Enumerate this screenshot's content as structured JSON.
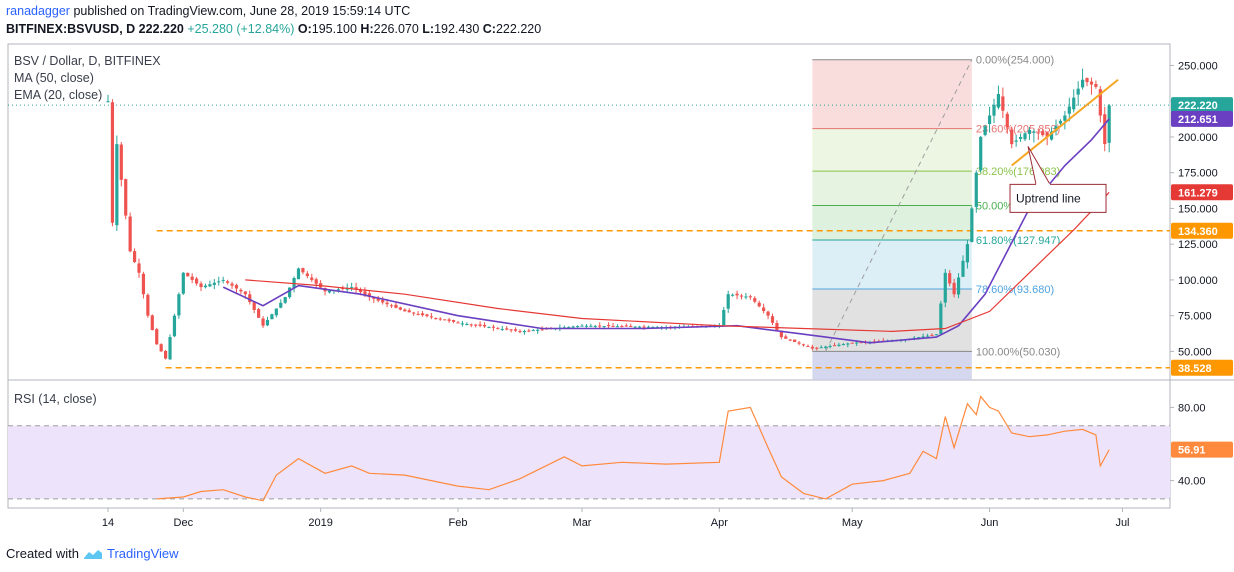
{
  "header": {
    "author": "ranadagger",
    "published_text": "published on TradingView.com, June 28, 2019 15:59:14 UTC",
    "symbol": "BITFINEX:BSVUSD, D",
    "last": "222.220",
    "change": "+25.280 (+12.84%)",
    "o_label": "O:",
    "o_value": "195.100",
    "h_label": "H:",
    "h_value": "226.070",
    "l_label": "L:",
    "l_value": "192.430",
    "c_label": "C:",
    "c_value": "222.220"
  },
  "legend": {
    "title": "BSV / Dollar, D, BITFINEX",
    "ma": "MA (50, close)",
    "ema": "EMA (20, close)",
    "rsi": "RSI (14, close)"
  },
  "footer": {
    "created_with": "Created with",
    "brand": "TradingView"
  },
  "colors": {
    "up": "#26a69a",
    "down": "#ef5350",
    "ma": "#6a3fc1",
    "ema": "#e53935",
    "support": "#ff9800",
    "uptrend": "#f5a623",
    "rsi": "#ff8a3d",
    "rsi_band": "#ede4fb"
  },
  "chart_data": [
    {
      "type": "candlestick",
      "title": "BSV / Dollar, D, BITFINEX",
      "ylim": [
        30,
        265
      ],
      "y_ticks": [
        50,
        75,
        100,
        125,
        150,
        175,
        200,
        225,
        250
      ],
      "y_tick_labels": [
        "50.000",
        "75.000",
        "100.000",
        "125.000",
        "150.000",
        "175.000",
        "200.000",
        "225.000",
        "250.000"
      ],
      "x_ticks": [
        {
          "label": "14",
          "date": "2018-11-14"
        },
        {
          "label": "Dec",
          "date": "2018-12-01"
        },
        {
          "label": "2019",
          "date": "2019-01-01"
        },
        {
          "label": "Feb",
          "date": "2019-02-01"
        },
        {
          "label": "Mar",
          "date": "2019-03-01"
        },
        {
          "label": "Apr",
          "date": "2019-04-01"
        },
        {
          "label": "May",
          "date": "2019-05-01"
        },
        {
          "label": "Jun",
          "date": "2019-06-01"
        },
        {
          "label": "Jul",
          "date": "2019-07-01"
        }
      ],
      "date_range": [
        "2018-11-14",
        "2019-06-28"
      ],
      "price_control_points": [
        [
          "2018-11-14",
          225
        ],
        [
          "2018-11-15",
          140
        ],
        [
          "2018-11-16",
          195
        ],
        [
          "2018-11-17",
          170
        ],
        [
          "2018-11-19",
          120
        ],
        [
          "2018-11-21",
          105
        ],
        [
          "2018-11-23",
          75
        ],
        [
          "2018-11-25",
          55
        ],
        [
          "2018-11-27",
          45
        ],
        [
          "2018-11-29",
          75
        ],
        [
          "2018-12-01",
          105
        ],
        [
          "2018-12-05",
          95
        ],
        [
          "2018-12-10",
          100
        ],
        [
          "2018-12-15",
          90
        ],
        [
          "2018-12-19",
          68
        ],
        [
          "2018-12-24",
          88
        ],
        [
          "2018-12-27",
          108
        ],
        [
          "2019-01-02",
          92
        ],
        [
          "2019-01-08",
          95
        ],
        [
          "2019-01-12",
          88
        ],
        [
          "2019-01-20",
          78
        ],
        [
          "2019-02-01",
          70
        ],
        [
          "2019-02-15",
          64
        ],
        [
          "2019-03-01",
          68
        ],
        [
          "2019-03-20",
          67
        ],
        [
          "2019-04-01",
          68
        ],
        [
          "2019-04-03",
          90
        ],
        [
          "2019-04-08",
          88
        ],
        [
          "2019-04-12",
          75
        ],
        [
          "2019-04-15",
          60
        ],
        [
          "2019-04-22",
          52
        ],
        [
          "2019-05-01",
          56
        ],
        [
          "2019-05-12",
          58
        ],
        [
          "2019-05-20",
          62
        ],
        [
          "2019-05-22",
          105
        ],
        [
          "2019-05-24",
          90
        ],
        [
          "2019-05-27",
          125
        ],
        [
          "2019-05-30",
          200
        ],
        [
          "2019-06-03",
          230
        ],
        [
          "2019-06-06",
          195
        ],
        [
          "2019-06-10",
          205
        ],
        [
          "2019-06-14",
          200
        ],
        [
          "2019-06-18",
          215
        ],
        [
          "2019-06-22",
          240
        ],
        [
          "2019-06-25",
          235
        ],
        [
          "2019-06-26",
          215
        ],
        [
          "2019-06-27",
          195
        ],
        [
          "2019-06-28",
          222
        ]
      ],
      "ma50_control_points": [
        [
          "2018-12-10",
          95
        ],
        [
          "2018-12-19",
          82
        ],
        [
          "2018-12-27",
          96
        ],
        [
          "2019-01-10",
          90
        ],
        [
          "2019-02-01",
          75
        ],
        [
          "2019-02-20",
          66
        ],
        [
          "2019-03-15",
          66
        ],
        [
          "2019-04-05",
          68
        ],
        [
          "2019-04-20",
          62
        ],
        [
          "2019-05-05",
          56
        ],
        [
          "2019-05-20",
          60
        ],
        [
          "2019-05-25",
          68
        ],
        [
          "2019-05-31",
          90
        ],
        [
          "2019-06-10",
          150
        ],
        [
          "2019-06-18",
          180
        ],
        [
          "2019-06-24",
          198
        ],
        [
          "2019-06-28",
          212.651
        ]
      ],
      "ema20_control_points": [
        [
          "2018-12-15",
          100
        ],
        [
          "2019-01-01",
          96
        ],
        [
          "2019-01-20",
          90
        ],
        [
          "2019-02-10",
          80
        ],
        [
          "2019-03-01",
          73
        ],
        [
          "2019-04-01",
          68
        ],
        [
          "2019-04-20",
          66
        ],
        [
          "2019-05-10",
          64
        ],
        [
          "2019-05-22",
          66
        ],
        [
          "2019-06-01",
          78
        ],
        [
          "2019-06-10",
          105
        ],
        [
          "2019-06-20",
          135
        ],
        [
          "2019-06-28",
          161.279
        ]
      ],
      "support_lines": [
        {
          "value": 134.36,
          "label": "134.360",
          "from": "2018-11-25",
          "to": "2019-06-28"
        },
        {
          "value": 38.528,
          "label": "38.528",
          "from": "2018-11-27",
          "to": "2019-06-28"
        }
      ],
      "last_price_line": {
        "value": 222.22
      },
      "price_labels": [
        {
          "value": 222.22,
          "label": "222.220",
          "kind": "last"
        },
        {
          "value": 212.651,
          "label": "212.651",
          "kind": "ma"
        },
        {
          "value": 161.279,
          "label": "161.279",
          "kind": "ema"
        },
        {
          "value": 134.36,
          "label": "134.360",
          "kind": "support"
        },
        {
          "value": 38.528,
          "label": "38.528",
          "kind": "support"
        }
      ],
      "fibonacci": {
        "from": "2019-04-22",
        "to": "2019-05-28",
        "levels": [
          {
            "ratio": "0.00%",
            "value": 254.0,
            "label": "0.00%(254.000)"
          },
          {
            "ratio": "23.60%",
            "value": 205.853,
            "label": "23.60%(205.853)"
          },
          {
            "ratio": "38.20%",
            "value": 176.083,
            "label": "38.20%(176.083)"
          },
          {
            "ratio": "50.00%",
            "value": 152.015,
            "label": "50.00%(152.015)"
          },
          {
            "ratio": "61.80%",
            "value": 127.947,
            "label": "61.80%(127.947)"
          },
          {
            "ratio": "78.60%",
            "value": 93.68,
            "label": "78.60%(93.680)"
          },
          {
            "ratio": "100.00%",
            "value": 50.03,
            "label": "100.00%(50.030)"
          }
        ]
      },
      "trend_line": {
        "from": [
          "2019-06-06",
          180
        ],
        "to": [
          "2019-06-30",
          240
        ]
      },
      "annotations": [
        {
          "text": "Uptrend line",
          "date": "2019-06-16",
          "value": 157
        }
      ]
    },
    {
      "type": "line",
      "title": "RSI (14, close)",
      "ylim": [
        25,
        95
      ],
      "y_ticks": [
        40,
        80
      ],
      "y_tick_labels": [
        "40.00",
        "80.00"
      ],
      "band": [
        30,
        70
      ],
      "last_value": "56.91",
      "rsi_control_points": [
        [
          "2018-11-25",
          30
        ],
        [
          "2018-12-01",
          31
        ],
        [
          "2018-12-05",
          34
        ],
        [
          "2018-12-10",
          35
        ],
        [
          "2018-12-15",
          31
        ],
        [
          "2018-12-19",
          29
        ],
        [
          "2018-12-22",
          43
        ],
        [
          "2018-12-27",
          52
        ],
        [
          "2019-01-02",
          44
        ],
        [
          "2019-01-08",
          48
        ],
        [
          "2019-01-12",
          44
        ],
        [
          "2019-01-20",
          43
        ],
        [
          "2019-02-01",
          37
        ],
        [
          "2019-02-08",
          35
        ],
        [
          "2019-02-15",
          41
        ],
        [
          "2019-02-25",
          53
        ],
        [
          "2019-03-01",
          48
        ],
        [
          "2019-03-10",
          50
        ],
        [
          "2019-03-20",
          49
        ],
        [
          "2019-04-01",
          50
        ],
        [
          "2019-04-03",
          78
        ],
        [
          "2019-04-08",
          80
        ],
        [
          "2019-04-12",
          58
        ],
        [
          "2019-04-15",
          42
        ],
        [
          "2019-04-20",
          33
        ],
        [
          "2019-04-25",
          30
        ],
        [
          "2019-05-01",
          38
        ],
        [
          "2019-05-08",
          40
        ],
        [
          "2019-05-14",
          44
        ],
        [
          "2019-05-17",
          56
        ],
        [
          "2019-05-20",
          52
        ],
        [
          "2019-05-22",
          75
        ],
        [
          "2019-05-24",
          58
        ],
        [
          "2019-05-27",
          82
        ],
        [
          "2019-05-29",
          76
        ],
        [
          "2019-05-30",
          86
        ],
        [
          "2019-06-01",
          80
        ],
        [
          "2019-06-03",
          78
        ],
        [
          "2019-06-06",
          66
        ],
        [
          "2019-06-10",
          64
        ],
        [
          "2019-06-14",
          65
        ],
        [
          "2019-06-18",
          67
        ],
        [
          "2019-06-22",
          68
        ],
        [
          "2019-06-25",
          65
        ],
        [
          "2019-06-26",
          48
        ],
        [
          "2019-06-28",
          56.91
        ]
      ]
    }
  ]
}
